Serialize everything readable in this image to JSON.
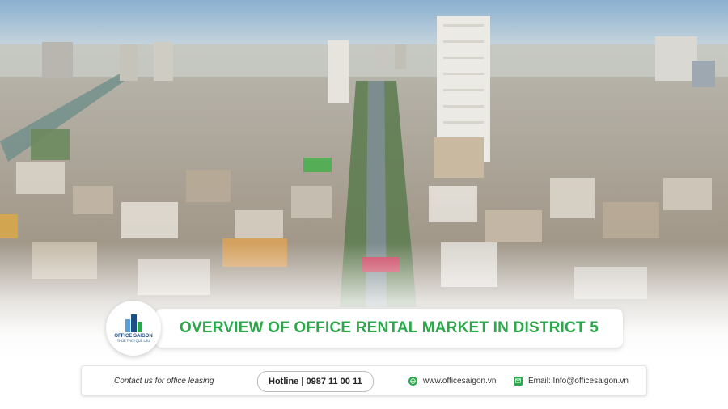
{
  "banner": {
    "title": "OVERVIEW OF OFFICE RENTAL MARKET IN DISTRICT 5"
  },
  "logo": {
    "name": "OFFICE SAIGON",
    "tagline": "THUÊ THỜI QUÁ LÂU",
    "icon": "building-logo-icon"
  },
  "contact": {
    "cta": "Contact us for office leasing",
    "hotline": "Hotline | 0987 11 00 11",
    "website": "www.officesaigon.vn",
    "email": "Email: Info@officesaigon.vn",
    "website_icon": "globe-icon",
    "email_icon": "mail-icon"
  },
  "colors": {
    "accent": "#2aa84a",
    "brand": "#1f4f82"
  }
}
